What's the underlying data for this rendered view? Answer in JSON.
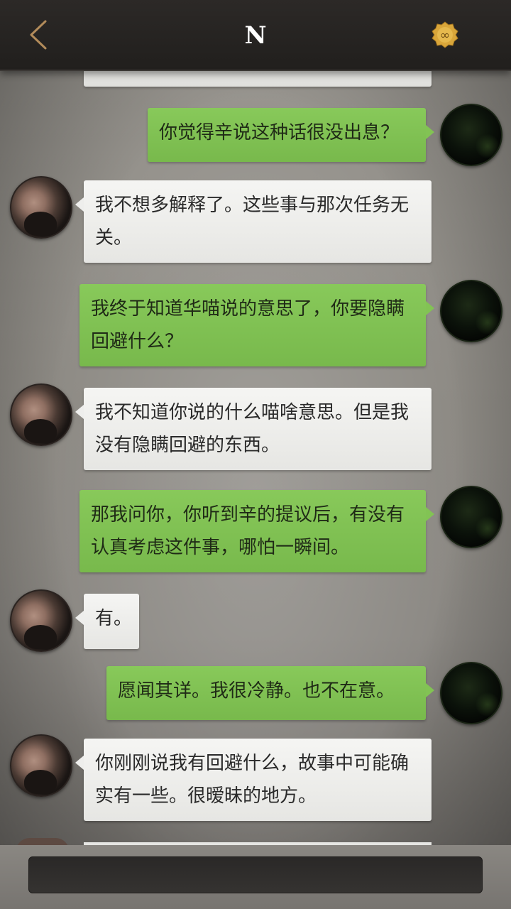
{
  "header": {
    "title": "N",
    "back_icon": "chevron-left-icon",
    "badge_icon": "infinity-badge-icon",
    "badge_symbol": "∞",
    "accent_back": "#b28b5a",
    "accent_badge": "#d9a63a"
  },
  "messages": [
    {
      "from": "me",
      "text": "你觉得辛说这种话很没出息？"
    },
    {
      "from": "other",
      "text": "我不想多解释了。这些事与那次任务无关。"
    },
    {
      "from": "me",
      "text": "我终于知道华喵说的意思了，你要隐瞒回避什么？"
    },
    {
      "from": "other",
      "text": "我不知道你说的什么喵啥意思。但是我没有隐瞒回避的东西。"
    },
    {
      "from": "me",
      "text": "那我问你，你听到辛的提议后，有没有认真考虑这件事，哪怕一瞬间。"
    },
    {
      "from": "other",
      "text": "有。"
    },
    {
      "from": "me",
      "text": "愿闻其详。我很冷静。也不在意。"
    },
    {
      "from": "other",
      "text": "你刚刚说我有回避什么，故事中可能确实有一些。很暧昧的地方。"
    }
  ],
  "colors": {
    "bubble_me": "#7dbe50",
    "bubble_other": "#eeeeec",
    "topbar": "#25221f",
    "background": "#8f8c86"
  },
  "input": {
    "value": "",
    "placeholder": ""
  }
}
